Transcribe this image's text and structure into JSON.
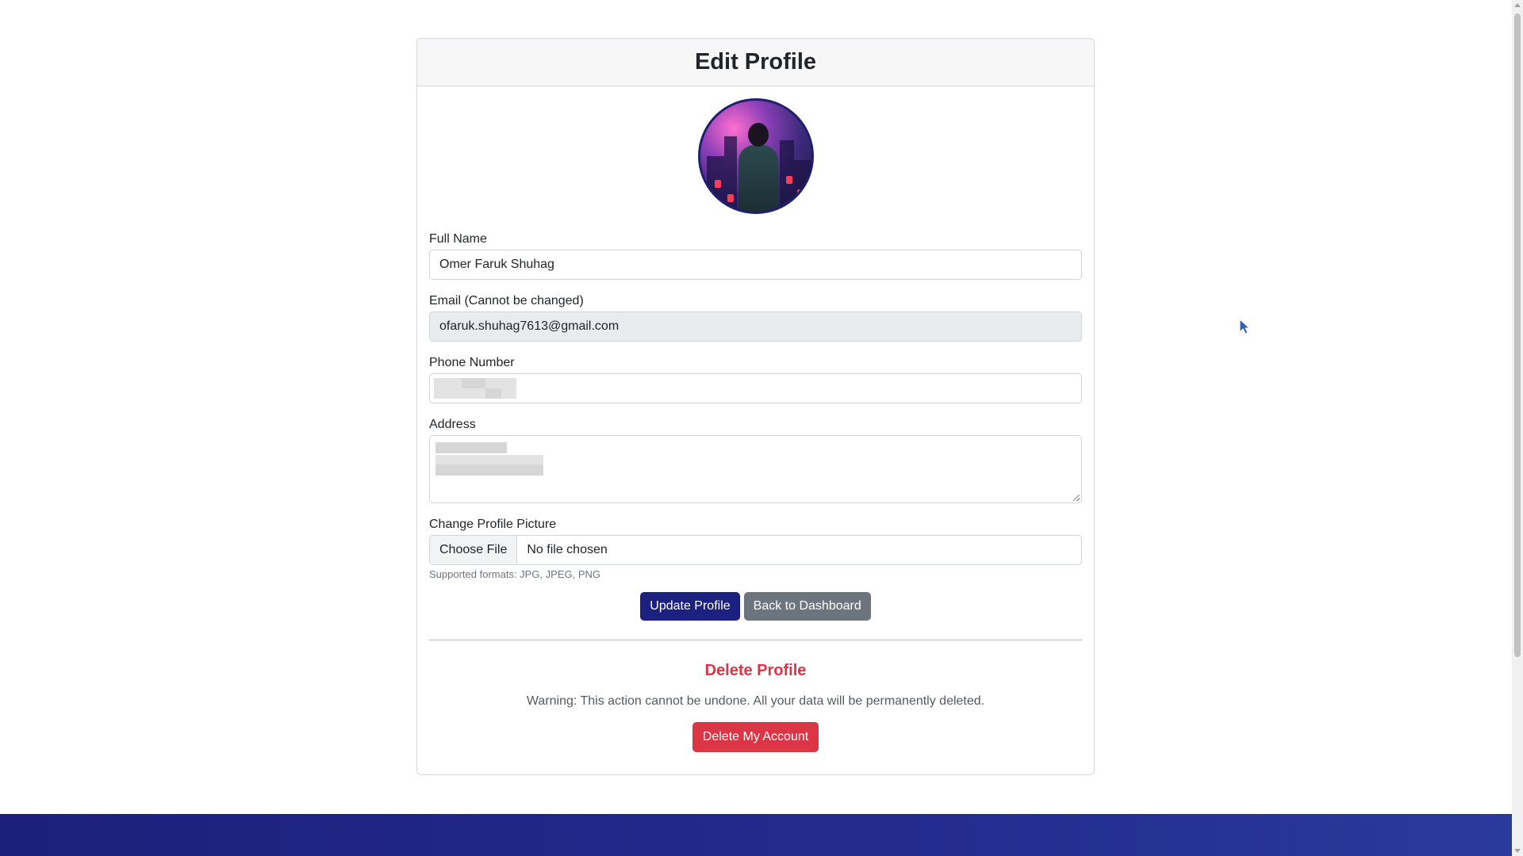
{
  "page": {
    "title": "Edit Profile"
  },
  "form": {
    "full_name": {
      "label": "Full Name",
      "value": "Omer Faruk Shuhag"
    },
    "email": {
      "label": "Email (Cannot be changed)",
      "value": "ofaruk.shuhag7613@gmail.com"
    },
    "phone": {
      "label": "Phone Number",
      "value": ""
    },
    "address": {
      "label": "Address",
      "value": ""
    },
    "picture": {
      "label": "Change Profile Picture",
      "button_label": "Choose File",
      "file_status": "No file chosen",
      "help": "Supported formats: JPG, JPEG, PNG"
    }
  },
  "actions": {
    "update_label": "Update Profile",
    "back_label": "Back to Dashboard"
  },
  "danger_zone": {
    "title": "Delete Profile",
    "warning": "Warning: This action cannot be undone. All your data will be permanently deleted.",
    "delete_label": "Delete My Account"
  },
  "colors": {
    "primary": "#1c2180",
    "secondary": "#6c757d",
    "danger": "#dc3545",
    "footer": "#1c207a"
  }
}
